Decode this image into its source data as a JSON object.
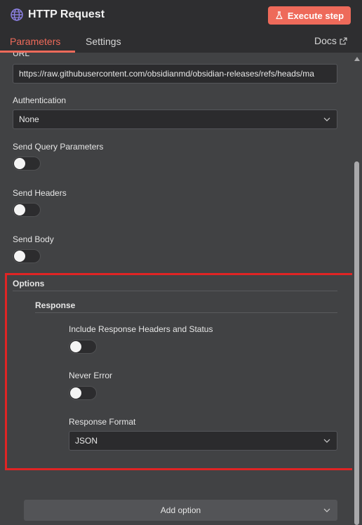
{
  "header": {
    "title": "HTTP Request",
    "execute_label": "Execute step",
    "tabs": [
      {
        "label": "Parameters"
      },
      {
        "label": "Settings"
      }
    ],
    "docs_label": "Docs"
  },
  "fields": {
    "url_label": "URL",
    "url_value": "https://raw.githubusercontent.com/obsidianmd/obsidian-releases/refs/heads/ma",
    "auth_label": "Authentication",
    "auth_value": "None",
    "send_query_label": "Send Query Parameters",
    "send_query_on": false,
    "send_headers_label": "Send Headers",
    "send_headers_on": false,
    "send_body_label": "Send Body",
    "send_body_on": false
  },
  "options": {
    "title": "Options",
    "response_title": "Response",
    "include_headers_label": "Include Response Headers and Status",
    "include_headers_on": false,
    "never_error_label": "Never Error",
    "never_error_on": false,
    "format_label": "Response Format",
    "format_value": "JSON"
  },
  "add_option_label": "Add option",
  "colors": {
    "accent": "#ee6a5a",
    "highlight": "#e02424",
    "background": "#414244",
    "header": "#2e2e30"
  }
}
